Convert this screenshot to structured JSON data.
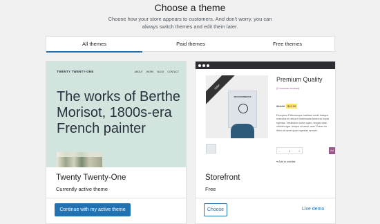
{
  "header": {
    "title": "Choose a theme",
    "subtitle": "Choose how your store appears to customers. And don't worry, you can always switch themes and edit them later."
  },
  "tabs": [
    {
      "label": "All themes",
      "active": true
    },
    {
      "label": "Paid themes",
      "active": false
    },
    {
      "label": "Free themes",
      "active": false
    }
  ],
  "themes": [
    {
      "name": "Twenty Twenty-One",
      "status": "Currently active theme",
      "primary_action": "Continue with my active theme",
      "preview": {
        "site_title": "TWENTY TWENTY-ONE",
        "nav": [
          "ABOUT",
          "WORK",
          "BLOG",
          "CONTACT"
        ],
        "headline": "The works of Berthe Morisot, 1800s-era French painter",
        "background_color": "#d1e4dd"
      }
    },
    {
      "name": "Storefront",
      "status": "Free",
      "secondary_action": "Choose",
      "link": "Live demo",
      "preview": {
        "ribbon": "Sale!",
        "poster_text": "WOOCOMMERCE",
        "product_title": "Premium Quality",
        "reviews": "(2 customer reviews)",
        "old_price": "$16.00",
        "new_price": "$12.00",
        "description": "Excepteur Pellentesque habitant morbi tristique senectus et netus et malesuada fames ac turpis egestas. Vestibulum tortor quam, feugiat vitae, ultricies eget, tempor sit amet, ante. Donec eu libero sit amet quam egestas semper.",
        "qty_minus": "-",
        "qty_value": "1",
        "qty_plus": "+",
        "add_button": "Ad",
        "wishlist": "Add to wishlist"
      }
    }
  ],
  "colors": {
    "accent": "#2271b1",
    "page_background": "#f0f0f1",
    "storefront_bar": "#2c2d33",
    "woocommerce_purple": "#96588a"
  }
}
